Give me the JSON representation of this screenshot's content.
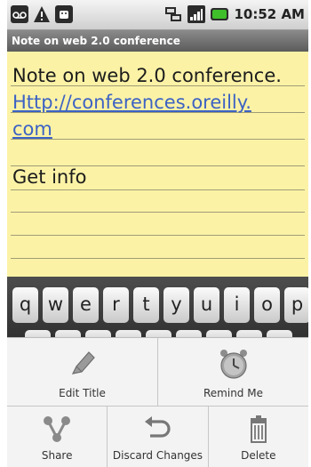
{
  "status_bar": {
    "time": "10:52 AM",
    "left_icons": [
      "voicemail-icon",
      "warning-icon",
      "android-icon"
    ],
    "right_icons": [
      "network-icon",
      "signal-icon",
      "battery-icon"
    ]
  },
  "title_bar": {
    "title": "Note on web 2.0 conference"
  },
  "note": {
    "lines": [
      {
        "text": "Note on web 2.0 conference.",
        "is_link": false
      },
      {
        "text": "Http://conferences.oreilly.",
        "is_link": true
      },
      {
        "text": "com",
        "is_link": true
      },
      {
        "text": "",
        "is_link": false
      },
      {
        "text": "Get info",
        "is_link": false
      }
    ]
  },
  "keyboard": {
    "keys": [
      "q",
      "w",
      "e",
      "r",
      "t",
      "y",
      "u",
      "i",
      "o",
      "p"
    ]
  },
  "menu": {
    "edit_title": "Edit Title",
    "remind_me": "Remind Me",
    "share": "Share",
    "discard_changes": "Discard Changes",
    "delete": "Delete"
  },
  "colors": {
    "note_background": "#fbf2a6",
    "link": "#3c62c4",
    "battery": "#3fbf2a",
    "title_bar": "#6e6e6e"
  }
}
